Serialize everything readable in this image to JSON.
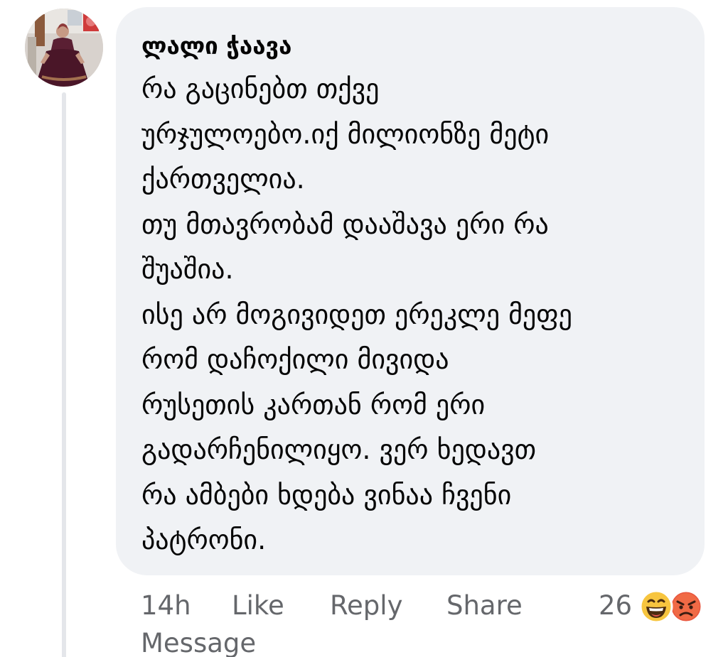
{
  "comment": {
    "author": "ლალი ჭაავა",
    "lines": [
      "რა გაცინებთ თქვე",
      "ურჯულოებო.იქ მილიონზე მეტი",
      "ქართველია.",
      "თუ მთავრობამ დააშავა ერი რა",
      "შუაშია.",
      "ისე არ მოგივიდეთ ერეკლე მეფე",
      "რომ დაჩოქილი მივიდა",
      "რუსეთის კართან რომ ერი",
      "გადარჩენილიყო. ვერ ხედავთ",
      "რა ამბები ხდება ვინაა ჩვენი",
      "პატრონი."
    ]
  },
  "actions": {
    "timestamp": "14h",
    "like_label": "Like",
    "reply_label": "Reply",
    "share_label": "Share",
    "message_label": "Message"
  },
  "reactions": {
    "count": "26",
    "types": [
      "haha-reaction-icon",
      "angry-reaction-icon"
    ]
  },
  "colors": {
    "bubble_background": "#f0f2f5",
    "text_primary": "#050505",
    "text_secondary": "#65676b",
    "thread_line": "#e4e6ea",
    "haha_yellow": "#f7c53f",
    "angry_red": "#e9573f"
  }
}
